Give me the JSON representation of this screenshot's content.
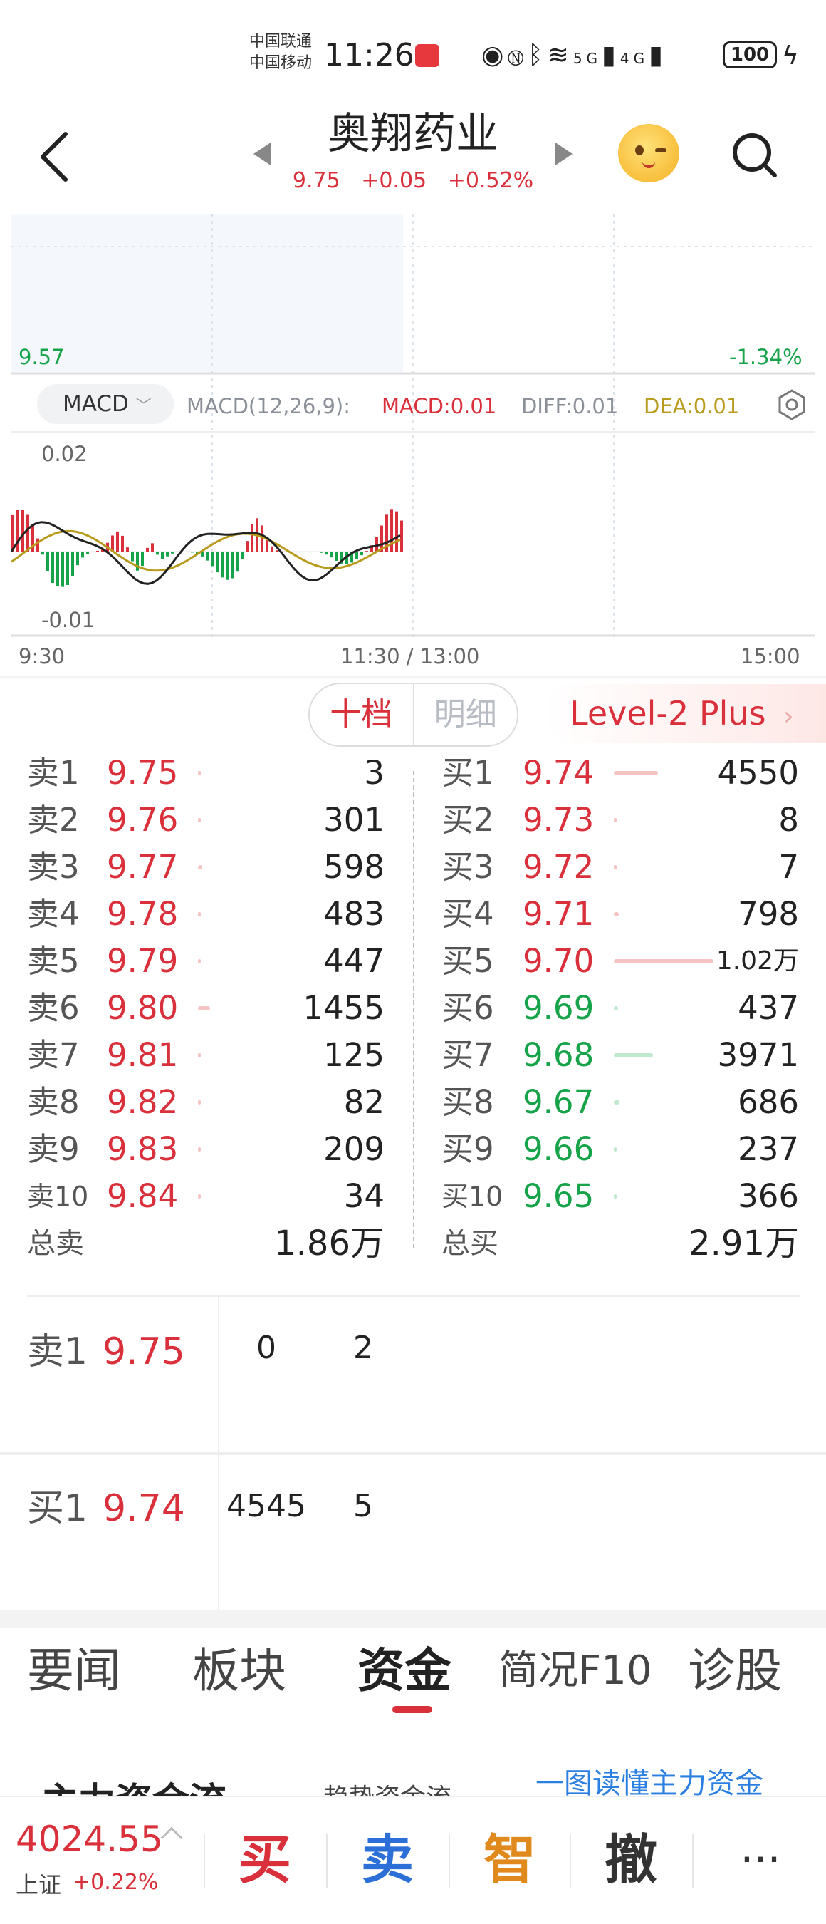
{
  "status_bar": {
    "carrier1": "中国联通",
    "carrier2": "中国移动",
    "time": "11:26",
    "signal_5g": "5G",
    "signal_4g": "4G",
    "battery": "100"
  },
  "header": {
    "stock_name": "奥翔药业",
    "price": "9.75",
    "change": "+0.05",
    "change_pct": "+0.52%"
  },
  "chart": {
    "low_price_label": "9.57",
    "low_pct_label": "-1.34%",
    "indicator_button": "MACD",
    "macd_params": "MACD(12,26,9):",
    "macd_value": "MACD:0.01",
    "diff_value": "DIFF:0.01",
    "dea_value": "DEA:0.01",
    "macd_top_label": "0.02",
    "macd_bottom_label": "-0.01",
    "time_start": "9:30",
    "time_mid": "11:30 / 13:00",
    "time_end": "15:00",
    "colors": {
      "up": "#d9303b",
      "down": "#17a34a",
      "diff": "#222222",
      "dea": "#b89a1c"
    }
  },
  "orderbook": {
    "tab_ten": "十档",
    "tab_detail": "明细",
    "level2": "Level-2 Plus",
    "asks": [
      {
        "label": "卖1",
        "price": "9.75",
        "vol": "3",
        "bar": 0.0
      },
      {
        "label": "卖2",
        "price": "9.76",
        "vol": "301",
        "bar": 0.02
      },
      {
        "label": "卖3",
        "price": "9.77",
        "vol": "598",
        "bar": 0.04
      },
      {
        "label": "卖4",
        "price": "9.78",
        "vol": "483",
        "bar": 0.03
      },
      {
        "label": "卖5",
        "price": "9.79",
        "vol": "447",
        "bar": 0.03
      },
      {
        "label": "卖6",
        "price": "9.80",
        "vol": "1455",
        "bar": 0.12
      },
      {
        "label": "卖7",
        "price": "9.81",
        "vol": "125",
        "bar": 0.01
      },
      {
        "label": "卖8",
        "price": "9.82",
        "vol": "82",
        "bar": 0.01
      },
      {
        "label": "卖9",
        "price": "9.83",
        "vol": "209",
        "bar": 0.02
      },
      {
        "label": "卖10",
        "price": "9.84",
        "vol": "34",
        "bar": 0.01
      }
    ],
    "bids": [
      {
        "label": "买1",
        "price": "9.74",
        "vol": "4550",
        "bar": 0.44,
        "color": "red"
      },
      {
        "label": "买2",
        "price": "9.73",
        "vol": "8",
        "bar": 0.0,
        "color": "red"
      },
      {
        "label": "买3",
        "price": "9.72",
        "vol": "7",
        "bar": 0.0,
        "color": "red"
      },
      {
        "label": "买4",
        "price": "9.71",
        "vol": "798",
        "bar": 0.05,
        "color": "red"
      },
      {
        "label": "买5",
        "price": "9.70",
        "vol": "1.02万",
        "bar": 1.0,
        "color": "red"
      },
      {
        "label": "买6",
        "price": "9.69",
        "vol": "437",
        "bar": 0.04,
        "color": "green"
      },
      {
        "label": "买7",
        "price": "9.68",
        "vol": "3971",
        "bar": 0.39,
        "color": "green"
      },
      {
        "label": "买8",
        "price": "9.67",
        "vol": "686",
        "bar": 0.06,
        "color": "green"
      },
      {
        "label": "买9",
        "price": "9.66",
        "vol": "237",
        "bar": 0.02,
        "color": "green"
      },
      {
        "label": "买10",
        "price": "9.65",
        "vol": "366",
        "bar": 0.03,
        "color": "green"
      }
    ],
    "total_sell_label": "总卖",
    "total_sell": "1.86万",
    "total_buy_label": "总买",
    "total_buy": "2.91万"
  },
  "trades": {
    "sell1_label": "卖1",
    "sell1_price": "9.75",
    "sell1_nums": [
      "0",
      "2"
    ],
    "buy1_label": "买1",
    "buy1_price": "9.74",
    "buy1_nums": [
      "4545",
      "5"
    ]
  },
  "news_tabs": [
    "要闻",
    "板块",
    "资金",
    "简况F10",
    "诊股"
  ],
  "flow": {
    "title": "主力资金流",
    "subtitle": "趋势资金流",
    "link": "一图读懂主力资金"
  },
  "bottom": {
    "index_value": "4024.55",
    "index_name": "上证",
    "index_change": "+0.22%",
    "buy": "买",
    "sell": "卖",
    "smart": "智",
    "cancel": "撤",
    "more": "···"
  }
}
